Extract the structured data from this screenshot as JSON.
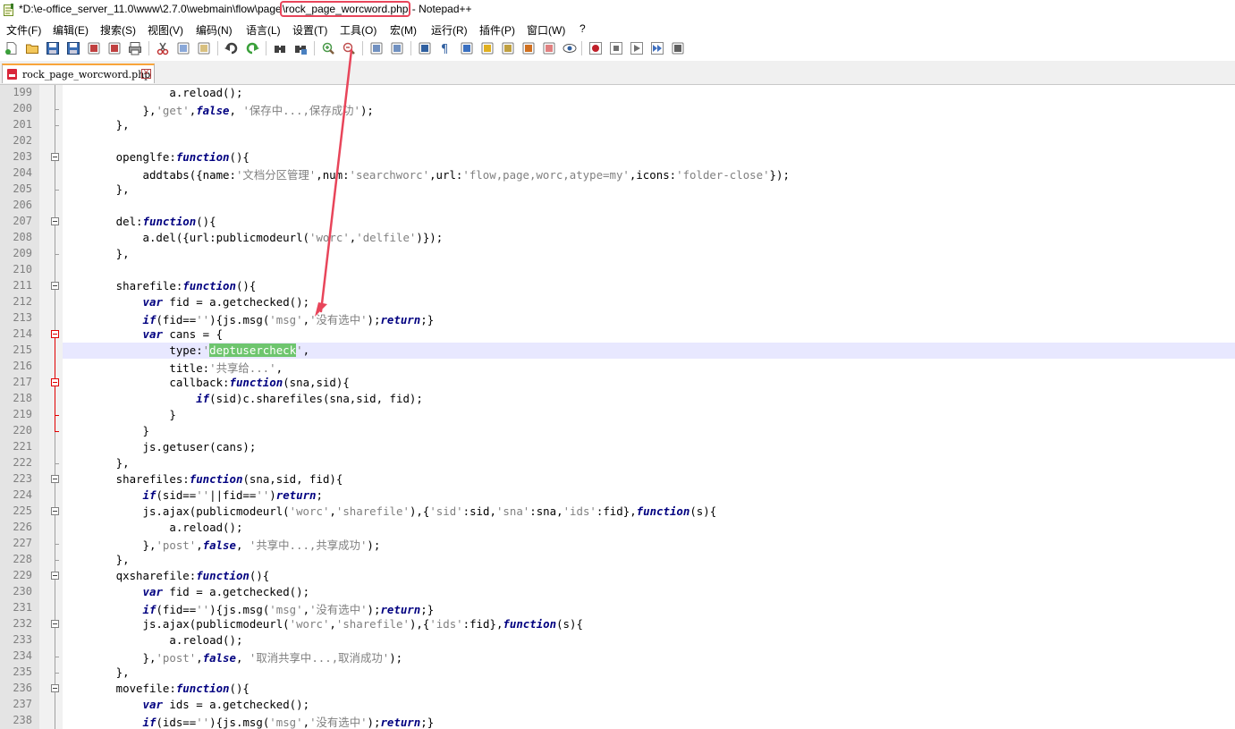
{
  "window": {
    "title_prefix": "*D:\\e-office_server_11.0\\www\\2.7.0\\webmain\\flow\\page",
    "title_file": "\\rock_page_worcword.php",
    "title_suffix": " - Notepad++"
  },
  "menu": [
    "文件(F)",
    "编辑(E)",
    "搜索(S)",
    "视图(V)",
    "编码(N)",
    "语言(L)",
    "设置(T)",
    "工具(O)",
    "宏(M)",
    "运行(R)",
    "插件(P)",
    "窗口(W)",
    "?"
  ],
  "toolbar_icons": [
    "new-file-icon",
    "open-file-icon",
    "save-icon",
    "save-all-icon",
    "close-icon",
    "close-all-icon",
    "print-icon",
    "cut-icon",
    "copy-icon",
    "paste-icon",
    "undo-icon",
    "redo-icon",
    "find-icon",
    "replace-icon",
    "zoom-in-icon",
    "zoom-out-icon",
    "sync-vertical-icon",
    "sync-horizontal-icon",
    "word-wrap-icon",
    "show-all-chars-icon",
    "indent-guide-icon",
    "user-lang-icon",
    "doc-map-icon",
    "function-list-icon",
    "folder-workspace-icon",
    "monitoring-icon",
    "record-macro-icon",
    "stop-macro-icon",
    "play-macro-icon",
    "run-macro-multiple-icon",
    "save-macro-icon"
  ],
  "tab": {
    "label": "rock_page_worcword.php"
  },
  "colors": {
    "keyword": "#000080",
    "string": "#808080",
    "selection": "#6ec56e",
    "annotation": "#e8455a",
    "current_line": "#e8e8ff"
  },
  "lines": [
    {
      "n": "199",
      "t": "\t\t\t\ta.reload();"
    },
    {
      "n": "200",
      "t": "\t\t\t},'get',false, '保存中...,保存成功');"
    },
    {
      "n": "201",
      "t": "\t\t},"
    },
    {
      "n": "202",
      "t": ""
    },
    {
      "n": "203",
      "t": "\t\topenglfe:function(){"
    },
    {
      "n": "204",
      "t": "\t\t\taddtabs({name:'文档分区管理',num:'searchworc',url:'flow,page,worc,atype=my',icons:'folder-close'});"
    },
    {
      "n": "205",
      "t": "\t\t},"
    },
    {
      "n": "206",
      "t": ""
    },
    {
      "n": "207",
      "t": "\t\tdel:function(){"
    },
    {
      "n": "208",
      "t": "\t\t\ta.del({url:publicmodeurl('worc','delfile')});"
    },
    {
      "n": "209",
      "t": "\t\t},"
    },
    {
      "n": "210",
      "t": ""
    },
    {
      "n": "211",
      "t": "\t\tsharefile:function(){"
    },
    {
      "n": "212",
      "t": "\t\t\tvar fid = a.getchecked();"
    },
    {
      "n": "213",
      "t": "\t\t\tif(fid==''){js.msg('msg','没有选中');return;}"
    },
    {
      "n": "214",
      "t": "\t\t\tvar cans = {"
    },
    {
      "n": "215",
      "t": "\t\t\t\ttype:'deptusercheck',"
    },
    {
      "n": "216",
      "t": "\t\t\t\ttitle:'共享给...',"
    },
    {
      "n": "217",
      "t": "\t\t\t\tcallback:function(sna,sid){"
    },
    {
      "n": "218",
      "t": "\t\t\t\t\tif(sid)c.sharefiles(sna,sid, fid);"
    },
    {
      "n": "219",
      "t": "\t\t\t\t}"
    },
    {
      "n": "220",
      "t": "\t\t\t}"
    },
    {
      "n": "221",
      "t": "\t\t\tjs.getuser(cans);"
    },
    {
      "n": "222",
      "t": "\t\t},"
    },
    {
      "n": "223",
      "t": "\t\tsharefiles:function(sna,sid, fid){"
    },
    {
      "n": "224",
      "t": "\t\t\tif(sid==''||fid=='')return;"
    },
    {
      "n": "225",
      "t": "\t\t\tjs.ajax(publicmodeurl('worc','sharefile'),{'sid':sid,'sna':sna,'ids':fid},function(s){"
    },
    {
      "n": "226",
      "t": "\t\t\t\ta.reload();"
    },
    {
      "n": "227",
      "t": "\t\t\t},'post',false, '共享中...,共享成功');"
    },
    {
      "n": "228",
      "t": "\t\t},"
    },
    {
      "n": "229",
      "t": "\t\tqxsharefile:function(){"
    },
    {
      "n": "230",
      "t": "\t\t\tvar fid = a.getchecked();"
    },
    {
      "n": "231",
      "t": "\t\t\tif(fid==''){js.msg('msg','没有选中');return;}"
    },
    {
      "n": "232",
      "t": "\t\t\tjs.ajax(publicmodeurl('worc','sharefile'),{'ids':fid},function(s){"
    },
    {
      "n": "233",
      "t": "\t\t\t\ta.reload();"
    },
    {
      "n": "234",
      "t": "\t\t\t},'post',false, '取消共享中...,取消成功');"
    },
    {
      "n": "235",
      "t": "\t\t},"
    },
    {
      "n": "236",
      "t": "\t\tmovefile:function(){"
    },
    {
      "n": "237",
      "t": "\t\t\tvar ids = a.getchecked();"
    },
    {
      "n": "238",
      "t": "\t\t\tif(ids==''){js.msg('msg','没有选中');return;}"
    }
  ]
}
